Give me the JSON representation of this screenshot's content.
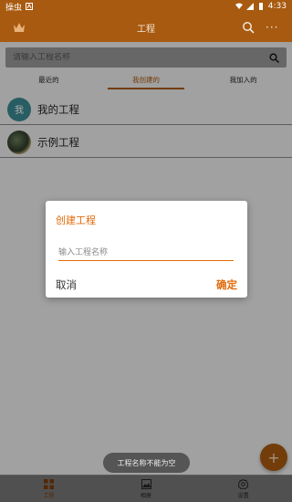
{
  "status_bar": {
    "left_text": "操虫",
    "time": "4:33",
    "icons": [
      "app-notification-icon",
      "wifi-icon",
      "signal-icon",
      "battery-icon"
    ]
  },
  "app_bar": {
    "title": "工程",
    "icons": [
      "crown-icon",
      "search-icon",
      "more-icon"
    ],
    "more_label": "···"
  },
  "search": {
    "placeholder": "请输入工程名称"
  },
  "tabs": [
    {
      "label": "最近的",
      "active": false
    },
    {
      "label": "我创建的",
      "active": true
    },
    {
      "label": "我加入的",
      "active": false
    }
  ],
  "list": [
    {
      "avatar_text": "我",
      "label": "我的工程"
    },
    {
      "avatar_text": "",
      "label": "示例工程"
    }
  ],
  "dialog": {
    "title": "创建工程",
    "input_placeholder": "输入工程名称",
    "input_value": "",
    "cancel_label": "取消",
    "ok_label": "确定"
  },
  "toast": {
    "message": "工程名称不能为空"
  },
  "fab": {
    "label": "+"
  },
  "bottom_nav": [
    {
      "label": "工程",
      "icon": "grid-icon",
      "active": true
    },
    {
      "label": "相册",
      "icon": "image-icon",
      "active": false
    },
    {
      "label": "设置",
      "icon": "gear-icon",
      "active": false
    }
  ],
  "colors": {
    "primary": "#a85a10",
    "accent": "#e06b0c"
  }
}
